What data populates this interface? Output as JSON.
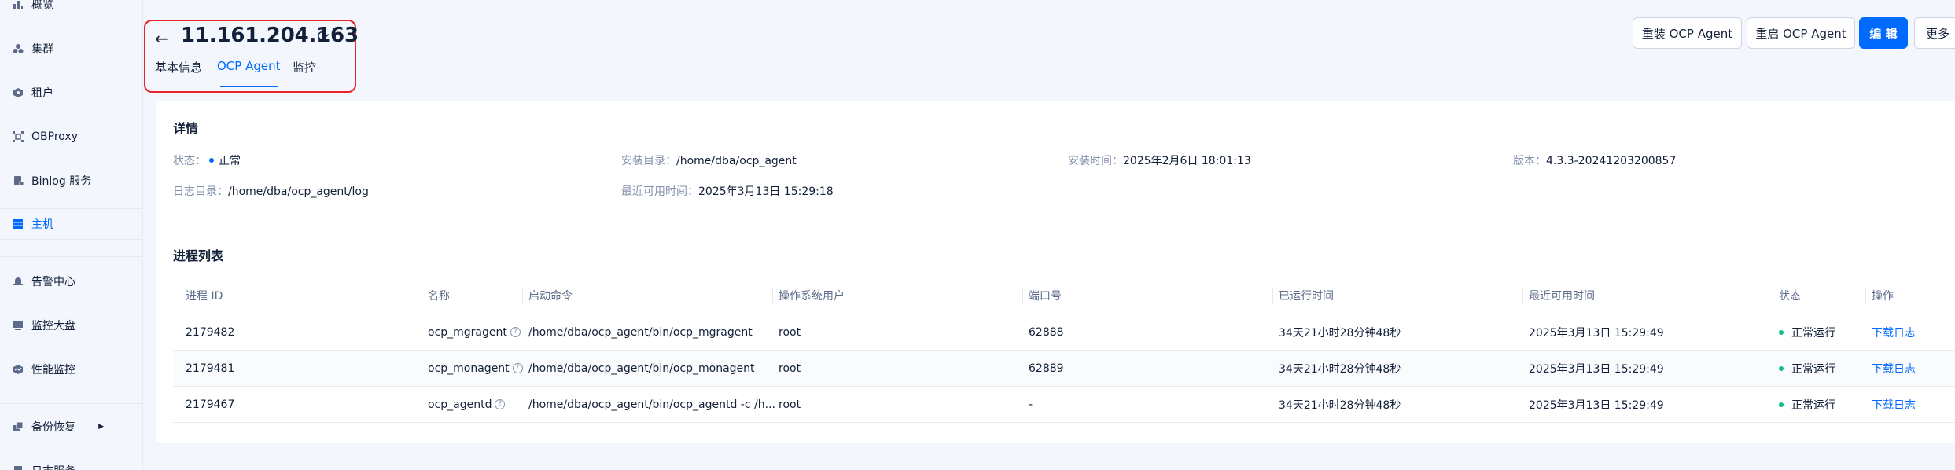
{
  "sidebar": {
    "items": [
      {
        "label": "概览",
        "icon": "bar-chart-icon"
      },
      {
        "label": "集群",
        "icon": "cluster-icon"
      },
      {
        "label": "租户",
        "icon": "tenant-icon"
      },
      {
        "label": "OBProxy",
        "icon": "proxy-icon"
      },
      {
        "label": "Binlog 服务",
        "icon": "binlog-icon"
      },
      {
        "label": "主机",
        "icon": "host-icon"
      },
      {
        "label": "告警中心",
        "icon": "alarm-icon"
      },
      {
        "label": "监控大盘",
        "icon": "dashboard-icon"
      },
      {
        "label": "性能监控",
        "icon": "performance-icon"
      },
      {
        "label": "备份恢复",
        "icon": "backup-icon",
        "arrow": "▶"
      },
      {
        "label": "日志服务",
        "icon": "log-icon"
      }
    ],
    "active_index": 5
  },
  "header": {
    "back_icon": "←",
    "title": "11.161.204.163",
    "refresh_icon": "⟳",
    "tabs": [
      "基本信息",
      "OCP Agent",
      "监控"
    ],
    "active_tab": 1
  },
  "actions": {
    "reinstall": "重装 OCP Agent",
    "restart": "重启 OCP Agent",
    "edit": "编 辑",
    "more": "更多"
  },
  "details": {
    "title": "详情",
    "status_label": "状态：",
    "status_value": "正常",
    "install_dir_label": "安装目录：",
    "install_dir_value": "/home/dba/ocp_agent",
    "install_time_label": "安装时间：",
    "install_time_value": "2025年2月6日 18:01:13",
    "version_label": "版本：",
    "version_value": "4.3.3-20241203200857",
    "log_dir_label": "日志目录：",
    "log_dir_value": "/home/dba/ocp_agent/log",
    "last_available_label": "最近可用时间：",
    "last_available_value": "2025年3月13日 15:29:18"
  },
  "process_list": {
    "title": "进程列表",
    "columns": [
      "进程 ID",
      "名称",
      "启动命令",
      "操作系统用户",
      "端口号",
      "已运行时间",
      "最近可用时间",
      "状态",
      "操作"
    ],
    "rows": [
      {
        "pid": "2179482",
        "name": "ocp_mgragent",
        "command": "/home/dba/ocp_agent/bin/ocp_mgragent",
        "user": "root",
        "port": "62888",
        "uptime": "34天21小时28分钟48秒",
        "last_available": "2025年3月13日 15:29:49",
        "status": "正常运行",
        "action": "下载日志"
      },
      {
        "pid": "2179481",
        "name": "ocp_monagent",
        "command": "/home/dba/ocp_agent/bin/ocp_monagent",
        "user": "root",
        "port": "62889",
        "uptime": "34天21小时28分钟48秒",
        "last_available": "2025年3月13日 15:29:49",
        "status": "正常运行",
        "action": "下载日志"
      },
      {
        "pid": "2179467",
        "name": "ocp_agentd",
        "command": "/home/dba/ocp_agent/bin/ocp_agentd -c /h...",
        "user": "root",
        "port": "-",
        "uptime": "34天21小时28分钟48秒",
        "last_available": "2025年3月13日 15:29:49",
        "status": "正常运行",
        "action": "下载日志"
      }
    ]
  },
  "colors": {
    "accent": "#006aff",
    "highlight_border": "#e8242c",
    "running": "#0ac185"
  }
}
